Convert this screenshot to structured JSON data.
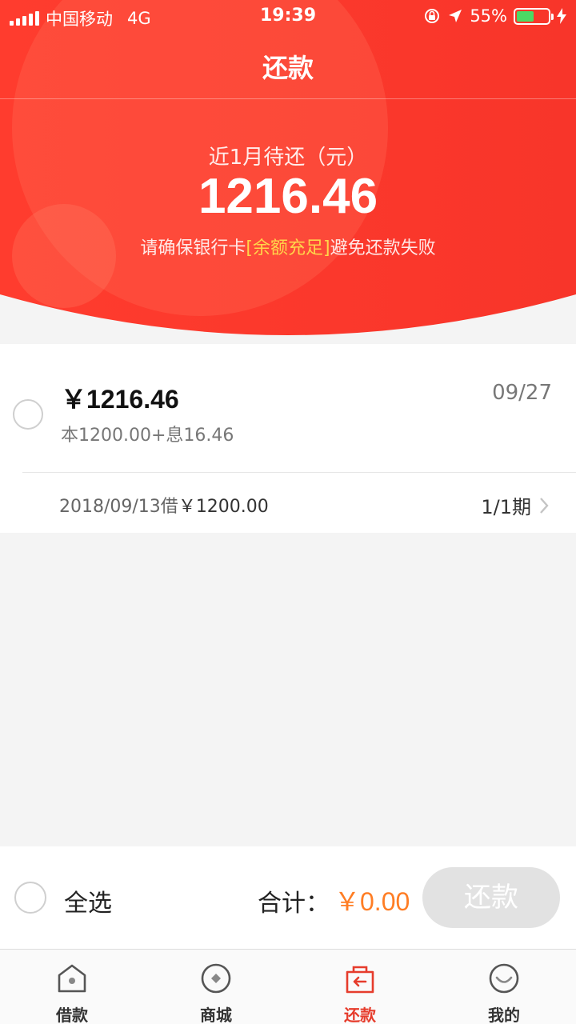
{
  "status_bar": {
    "carrier": "中国移动",
    "network": "4G",
    "time": "19:39",
    "battery": "55%",
    "battery_level": 0.55
  },
  "nav": {
    "title": "还款"
  },
  "summary": {
    "caption": "近1月待还（元）",
    "amount": "1216.46",
    "tip_prefix": "请确保银行卡",
    "tip_highlight": "[余额充足]",
    "tip_suffix": "避免还款失败"
  },
  "bill": {
    "amount": "￥1216.46",
    "due_date": "09/27",
    "detail": "本1200.00+息16.46",
    "borrow_prefix": "2018/09/13借",
    "borrow_amount": "￥1200.00",
    "period": "1/1期"
  },
  "action_bar": {
    "select_all": "全选",
    "total_label": "合计：",
    "total_value": "￥0.00",
    "pay_button": "还款"
  },
  "tabbar": {
    "items": [
      {
        "label": "借款",
        "icon": "home-icon",
        "active": false
      },
      {
        "label": "商城",
        "icon": "mall-icon",
        "active": false
      },
      {
        "label": "还款",
        "icon": "repay-icon",
        "active": true
      },
      {
        "label": "我的",
        "icon": "profile-icon",
        "active": false
      }
    ]
  },
  "colors": {
    "primary_red": "#f43a2c",
    "highlight_yellow": "#ffd54a",
    "total_orange": "#ff7d24",
    "active_tab": "#e63c2c"
  }
}
